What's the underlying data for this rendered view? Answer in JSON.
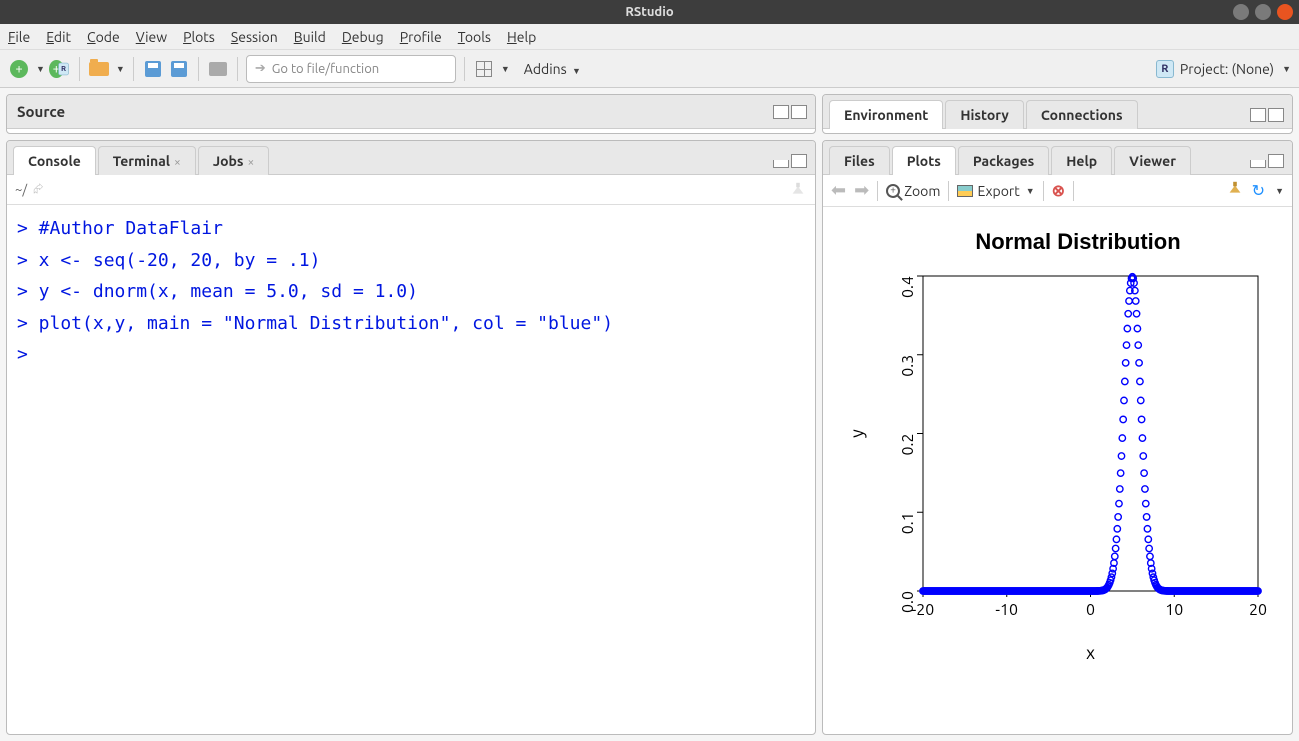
{
  "window": {
    "title": "RStudio"
  },
  "menu": [
    "File",
    "Edit",
    "Code",
    "View",
    "Plots",
    "Session",
    "Build",
    "Debug",
    "Profile",
    "Tools",
    "Help"
  ],
  "toolbar": {
    "goto_placeholder": "Go to file/function",
    "addins": "Addins",
    "project_label": "Project: (None)"
  },
  "panes": {
    "source": {
      "title": "Source"
    },
    "console_tabs": [
      {
        "label": "Console",
        "active": true,
        "closable": false
      },
      {
        "label": "Terminal",
        "active": false,
        "closable": true
      },
      {
        "label": "Jobs",
        "active": false,
        "closable": true
      }
    ],
    "console_prompt": "~/",
    "env_tabs": [
      {
        "label": "Environment",
        "active": true
      },
      {
        "label": "History",
        "active": false
      },
      {
        "label": "Connections",
        "active": false
      }
    ],
    "files_tabs": [
      {
        "label": "Files",
        "active": false
      },
      {
        "label": "Plots",
        "active": true
      },
      {
        "label": "Packages",
        "active": false
      },
      {
        "label": "Help",
        "active": false
      },
      {
        "label": "Viewer",
        "active": false
      }
    ],
    "plot_toolbar": {
      "zoom": "Zoom",
      "export": "Export"
    }
  },
  "console_lines": [
    "> #Author DataFlair",
    "> x <- seq(-20, 20, by = .1)",
    "> y <- dnorm(x, mean = 5.0, sd = 1.0)",
    "> plot(x,y, main = \"Normal Distribution\", col = \"blue\")",
    "> "
  ],
  "chart_data": {
    "type": "scatter",
    "title": "Normal Distribution",
    "xlabel": "x",
    "ylabel": "y",
    "xlim": [
      -20,
      20
    ],
    "ylim": [
      0,
      0.4
    ],
    "xticks": [
      -20,
      -10,
      0,
      10,
      20
    ],
    "yticks": [
      0.0,
      0.1,
      0.2,
      0.3,
      0.4
    ],
    "series": [
      {
        "name": "dnorm(x, mean=5, sd=1)",
        "color": "blue",
        "function": "normal_pdf(mean=5.0, sd=1.0)",
        "x_from": -20,
        "x_to": 20,
        "x_step": 0.1
      }
    ]
  }
}
